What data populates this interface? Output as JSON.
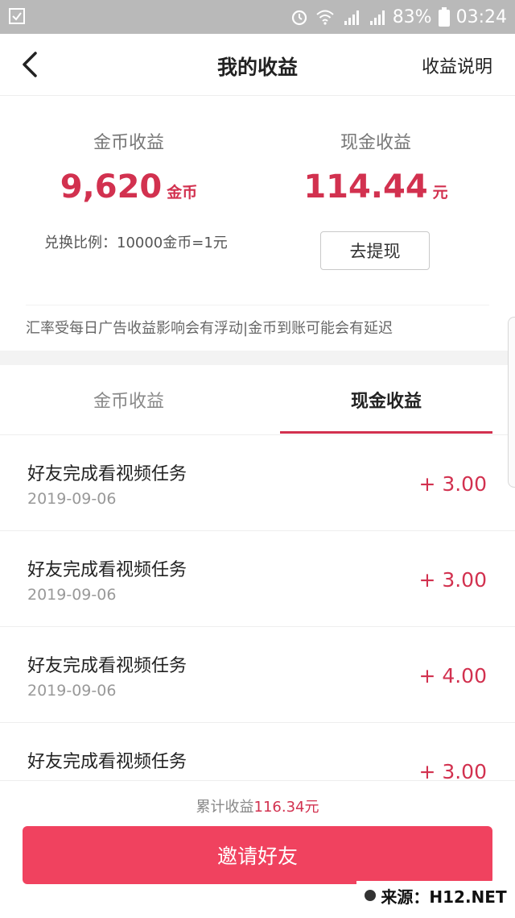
{
  "status_bar": {
    "battery": "83%",
    "time": "03:24",
    "icons": [
      "checklist-icon",
      "alarm-icon",
      "wifi-icon",
      "signal-4g-icon",
      "signal-e-icon",
      "battery-icon"
    ]
  },
  "nav": {
    "title": "我的收益",
    "right_link": "收益说明"
  },
  "summary": {
    "gold": {
      "label": "金币收益",
      "amount": "9,620",
      "unit": "金币"
    },
    "cash": {
      "label": "现金收益",
      "amount": "114.44",
      "unit": "元"
    },
    "ratio": "兑换比例：10000金币=1元",
    "withdraw_label": "去提现",
    "notice": "汇率受每日广告收益影响会有浮动|金币到账可能会有延迟"
  },
  "tabs": [
    {
      "label": "金币收益",
      "active": false
    },
    {
      "label": "现金收益",
      "active": true
    }
  ],
  "records": [
    {
      "title": "好友完成看视频任务",
      "date": "2019-09-06",
      "amount": "+ 3.00"
    },
    {
      "title": "好友完成看视频任务",
      "date": "2019-09-06",
      "amount": "+ 3.00"
    },
    {
      "title": "好友完成看视频任务",
      "date": "2019-09-06",
      "amount": "+ 4.00"
    },
    {
      "title": "好友完成看视频任务",
      "date": "",
      "amount": "+ 3.00"
    }
  ],
  "footer": {
    "total_prefix": "累计收益",
    "total_value": "116.34元",
    "invite_label": "邀请好友"
  },
  "watermark": "来源：H12.NET",
  "colors": {
    "accent": "#d2314f",
    "button": "#f0425f",
    "status_bar": "#b9b9b9"
  }
}
